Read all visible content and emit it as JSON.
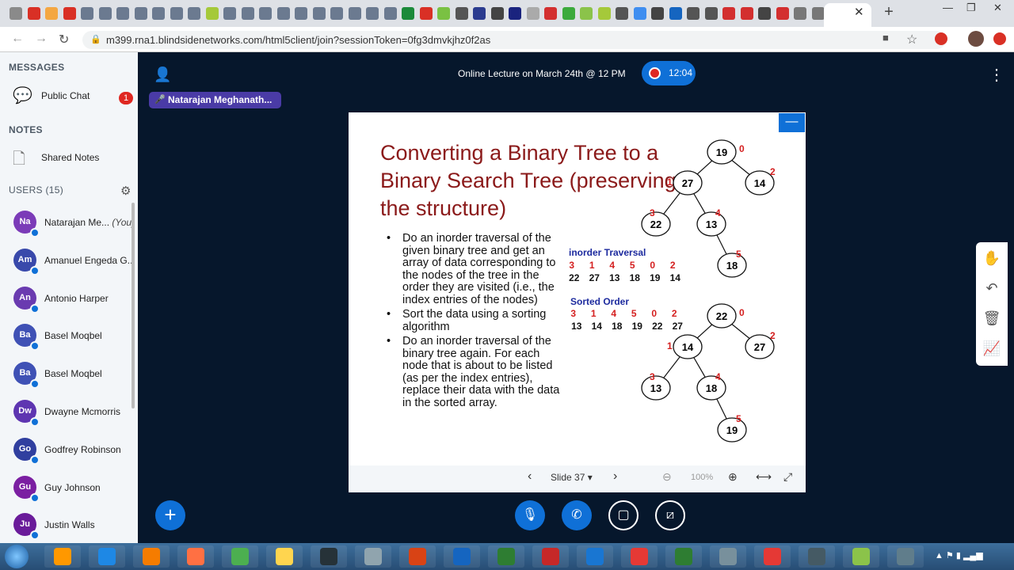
{
  "browser": {
    "url": "m399.rna1.blindsidenetworks.com/html5client/join?sessionToken=0fg3dmvkjhz0f2as",
    "favicon_colors": [
      "#8a8a8a",
      "#d93025",
      "#f4a742",
      "#d93025",
      "#6b7a90",
      "#6b7a90",
      "#6b7a90",
      "#6b7a90",
      "#6b7a90",
      "#6b7a90",
      "#6b7a90",
      "#a5c93a",
      "#6b7a90",
      "#6b7a90",
      "#6b7a90",
      "#6b7a90",
      "#6b7a90",
      "#6b7a90",
      "#6b7a90",
      "#6b7a90",
      "#6b7a90",
      "#6b7a90",
      "#1c8a3a",
      "#d93025",
      "#7ac143",
      "#555555",
      "#2b3b8f",
      "#444444",
      "#1a237e",
      "#aaaaaa",
      "#d32f2f",
      "#3caa3c",
      "#8bc34a",
      "#a5c93a",
      "#555555",
      "#3f8ef0",
      "#444444",
      "#1565c0",
      "#555555",
      "#555555",
      "#d32f2f",
      "#d32f2f",
      "#444444",
      "#d32f2f",
      "#777777",
      "#777777",
      "#e53935"
    ]
  },
  "sidebar": {
    "messages_title": "MESSAGES",
    "public_chat": "Public Chat",
    "public_chat_unread": "1",
    "notes_title": "NOTES",
    "shared_notes": "Shared Notes",
    "users_title": "USERS (15)",
    "users": [
      {
        "initials": "Na",
        "name": "Natarajan Me...",
        "suffix": "(You)",
        "color": "#7b3bb8"
      },
      {
        "initials": "Am",
        "name": "Amanuel Engeda G...",
        "suffix": "",
        "color": "#3949ab"
      },
      {
        "initials": "An",
        "name": "Antonio Harper",
        "suffix": "",
        "color": "#6a3bb0"
      },
      {
        "initials": "Ba",
        "name": "Basel Moqbel",
        "suffix": "",
        "color": "#3f51b5"
      },
      {
        "initials": "Ba",
        "name": "Basel Moqbel",
        "suffix": "",
        "color": "#3f51b5"
      },
      {
        "initials": "Dw",
        "name": "Dwayne Mcmorris",
        "suffix": "",
        "color": "#5e35b1"
      },
      {
        "initials": "Go",
        "name": "Godfrey Robinson",
        "suffix": "",
        "color": "#303f9f"
      },
      {
        "initials": "Gu",
        "name": "Guy Johnson",
        "suffix": "",
        "color": "#7b1fa2"
      },
      {
        "initials": "Ju",
        "name": "Justin Walls",
        "suffix": "",
        "color": "#6a1b9a"
      }
    ]
  },
  "header": {
    "title": "Online Lecture on March 24th @ 12 PM",
    "rec_time": "12:04",
    "talker": "Natarajan Meghanath..."
  },
  "slide": {
    "title": "Converting a Binary Tree to a Binary Search Tree (preserving the structure)",
    "bullets": [
      "Do an inorder traversal of the given binary tree and get an array of data corresponding to the nodes of the tree in the order they are visited (i.e., the index entries of the nodes)",
      "Sort the data using a sorting algorithm",
      "Do an inorder traversal of the binary tree again. For each node that is about to be listed (as per the index entries), replace their data with the data in the sorted array."
    ],
    "inorder_label": "inorder Traversal",
    "inorder_idx": [
      "3",
      "1",
      "4",
      "5",
      "0",
      "2"
    ],
    "inorder_vals": [
      "22",
      "27",
      "13",
      "18",
      "19",
      "14"
    ],
    "sorted_label": "Sorted Order",
    "sorted_idx": [
      "3",
      "1",
      "4",
      "5",
      "0",
      "2"
    ],
    "sorted_vals": [
      "13",
      "14",
      "18",
      "19",
      "22",
      "27"
    ],
    "tree1": {
      "nodes": [
        "19",
        "27",
        "14",
        "22",
        "13",
        "18"
      ],
      "idx": [
        "0",
        "1",
        "2",
        "3",
        "4",
        "5"
      ]
    },
    "tree2": {
      "nodes": [
        "22",
        "14",
        "27",
        "13",
        "18",
        "19"
      ],
      "idx": [
        "0",
        "1",
        "2",
        "3",
        "4",
        "5"
      ]
    },
    "nav": {
      "slide_label": "Slide 37",
      "zoom": "100%"
    }
  },
  "icons": {
    "prev": "‹",
    "next": "›",
    "zoom_out": "⊖",
    "zoom_in": "⊕",
    "fit": "⟷",
    "fullscreen": "⤢"
  }
}
